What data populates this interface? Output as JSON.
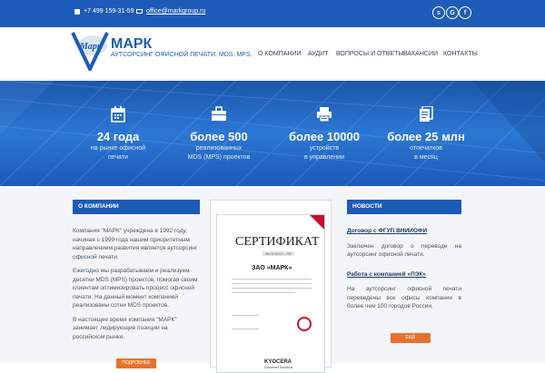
{
  "topbar": {
    "phone": "+7 499 159-31-59",
    "email": "office@markgroup.ru",
    "social": [
      "s",
      "G",
      "f"
    ]
  },
  "header": {
    "logo_text": "Марк",
    "brand": "МАРК",
    "tagline": "АУТСОРСИНГ ОФИСНОЙ ПЕЧАТИ. MDS. MPS.",
    "nav": [
      "О КОМПАНИИ",
      "АУДИТ",
      "ВОПРОСЫ И ОТВЕТЫ",
      "ВАКАНСИИ",
      "КОНТАКТЫ"
    ]
  },
  "stats": [
    {
      "icon": "calendar-icon",
      "number": "24 года",
      "label_1": "на рынке офисной",
      "label_2": "печати"
    },
    {
      "icon": "briefcase-icon",
      "number": "более 500",
      "label_1": "реализованных",
      "label_2": "MDS (MPS) проектов"
    },
    {
      "icon": "printer-icon",
      "number": "более 10000",
      "label_1": "устройств",
      "label_2": "в управлении"
    },
    {
      "icon": "documents-icon",
      "number": "более 25 млн",
      "label_1": "отпечатков",
      "label_2": "в месяц"
    }
  ],
  "about": {
    "heading": "О КОМПАНИИ",
    "p1": "Компания \"МАРК\" учреждена в 1992 году, начиная с 1999 года нашим приоритетным направлением развития является аутсорсинг офисной печати.",
    "p2": "Ежегодно мы разрабатываем и реализуем десятки MDS (MPS) проектов, помогая своим клиентам оптимизировать процесс офисной печати. На данный момент компанией реализованы сотни MDS проектов.",
    "p3": "В настоящее время компания \"МАРК\" занимает лидирующие позиции на российском рынке.",
    "more": "ПОДРОБНЕЕ"
  },
  "certificate": {
    "title": "СЕРТИФИКАТ",
    "number": "№ 01/2015 - РВ",
    "company": "ЗАО «МАРК»",
    "brand": "KYOCERA",
    "brand_sub": "Document Solutions"
  },
  "news": {
    "heading": "НОВОСТИ",
    "items": [
      {
        "title": "Договор с ФГУП ВНИИОФИ",
        "text": "Заключен договор о переводе на аутсорсинг офисной печати."
      },
      {
        "title": "Работа с компанией «ПЭК»",
        "text": "На аутсорсинг офисной печати переведены все офисы компании в более чем 100 городов России."
      }
    ],
    "more": "ЕЩЁ"
  },
  "colors": {
    "primary": "#1e5bb8",
    "accent": "#e8722a",
    "brand_text": "#1f5fae"
  }
}
